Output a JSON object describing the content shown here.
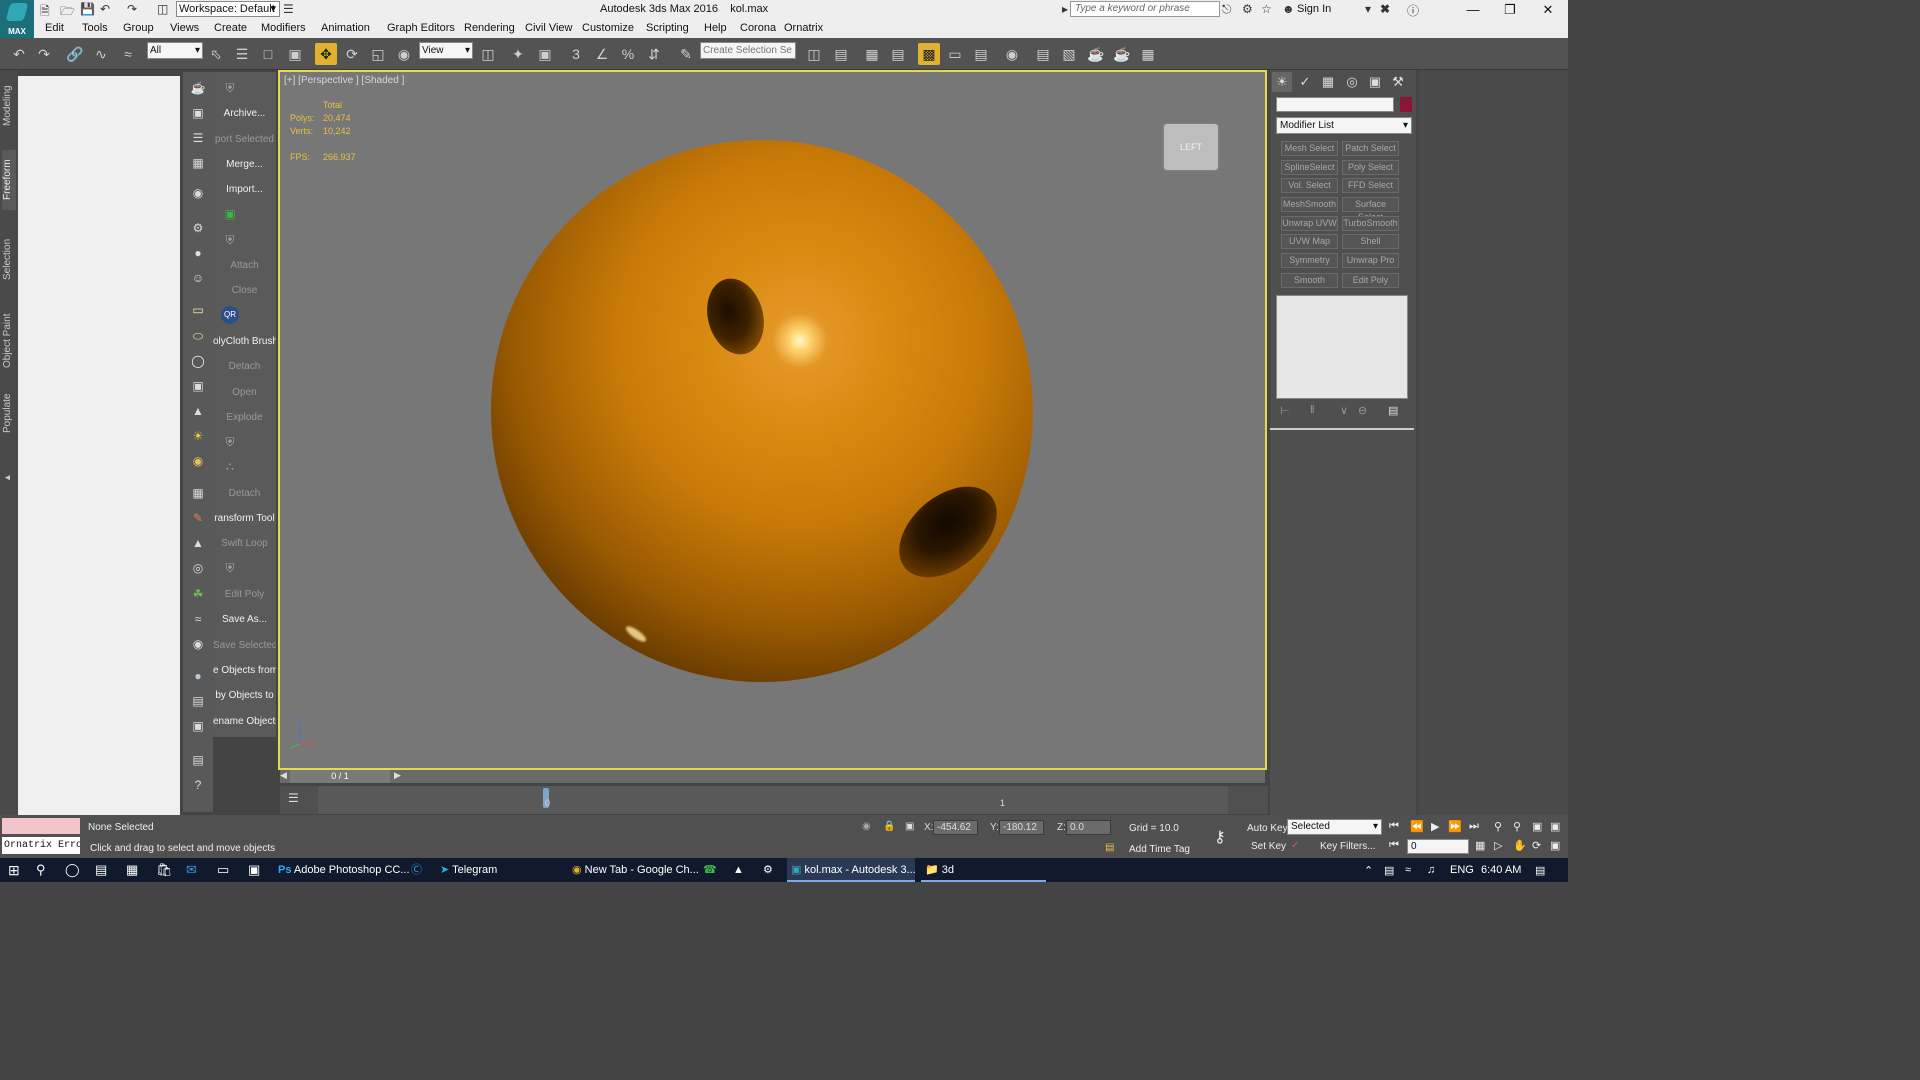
{
  "title_bar": {
    "app_title": "Autodesk 3ds Max 2016",
    "file_name": "kol.max",
    "logo_text": "MAX",
    "workspace": "Workspace: Default",
    "search_placeholder": "Type a keyword or phrase",
    "sign_in": "Sign In"
  },
  "menu": [
    "Edit",
    "Tools",
    "Group",
    "Views",
    "Create",
    "Modifiers",
    "Animation",
    "Graph Editors",
    "Rendering",
    "Civil View",
    "Customize",
    "Scripting",
    "Help",
    "Corona",
    "Ornatrix"
  ],
  "toolbar": {
    "filter_value": "All",
    "ref_coord_value": "View",
    "selection_set_placeholder": "Create Selection Se",
    "snap_label": "3",
    "percent_label": "%"
  },
  "left_tabs": [
    "Modeling",
    "Freeform",
    "Selection",
    "Object Paint",
    "Populate"
  ],
  "active_left_tab": "Freeform",
  "commands": [
    {
      "label": "Archive...",
      "enabled": true
    },
    {
      "label": "port Selected",
      "enabled": false
    },
    {
      "label": "Merge...",
      "enabled": true
    },
    {
      "label": "Import...",
      "enabled": true
    },
    {
      "label": "Attach",
      "enabled": false
    },
    {
      "label": "Close",
      "enabled": false
    },
    {
      "label": "olyCloth Brush",
      "enabled": true
    },
    {
      "label": "Detach",
      "enabled": false
    },
    {
      "label": "Open",
      "enabled": false
    },
    {
      "label": "Explode",
      "enabled": false
    },
    {
      "label": "Detach",
      "enabled": false
    },
    {
      "label": "ransform Tool",
      "enabled": true
    },
    {
      "label": "Swift Loop",
      "enabled": false
    },
    {
      "label": "Edit Poly",
      "enabled": false
    },
    {
      "label": "Save As...",
      "enabled": true
    },
    {
      "label": "Save Selected",
      "enabled": false
    },
    {
      "label": "e Objects from",
      "enabled": true
    },
    {
      "label": "by Objects to",
      "enabled": true
    },
    {
      "label": "ename Objects",
      "enabled": true
    }
  ],
  "command_qr": "QR",
  "viewport": {
    "label": "[+] [Perspective ] [Shaded ]",
    "stats_header": "Total",
    "polys_label": "Polys:",
    "polys_value": "20,474",
    "verts_label": "Verts:",
    "verts_value": "10,242",
    "fps_label": "FPS:",
    "fps_value": "266.937",
    "viewcube_label": "LEFT",
    "axis_z": "z",
    "axis_x": "x"
  },
  "timeslider": {
    "position": "0 / 1",
    "current_frame_fraction": 0,
    "track_tick_0": "0",
    "track_tick_1": "1"
  },
  "command_panel": {
    "modifier_list": "Modifier List",
    "object_color": "#8c1437",
    "modifier_buttons": [
      "Mesh Select",
      "Patch Select",
      "SplineSelect",
      "Poly Select",
      "Vol. Select",
      "FFD Select",
      "MeshSmooth",
      "Surface Select",
      "Unwrap UVW",
      "TurboSmooth",
      "UVW Map",
      "Shell",
      "Symmetry",
      "Unwrap Pro",
      "Smooth",
      "Edit Poly"
    ]
  },
  "status": {
    "maxscript_text": "Ornatrix Erro",
    "selection_status": "None Selected",
    "prompt": "Click and drag to select and move objects",
    "x_label": "X:",
    "x_value": "-454.62",
    "y_label": "Y:",
    "y_value": "-180.12",
    "z_label": "Z:",
    "z_value": "0.0",
    "grid": "Grid = 10.0",
    "add_time_tag": "Add Time Tag",
    "auto_key": "Auto Key",
    "set_key": "Set Key",
    "selected_dropdown": "Selected",
    "key_filters": "Key Filters...",
    "frame_value": "0"
  },
  "taskbar": {
    "items": [
      "Adobe Photoshop CC...",
      "Telegram",
      "New Tab - Google Ch...",
      "kol.max - Autodesk 3...",
      "3d"
    ],
    "active_item": "kol.max - Autodesk 3...",
    "language": "ENG",
    "time": "6:40 AM"
  }
}
